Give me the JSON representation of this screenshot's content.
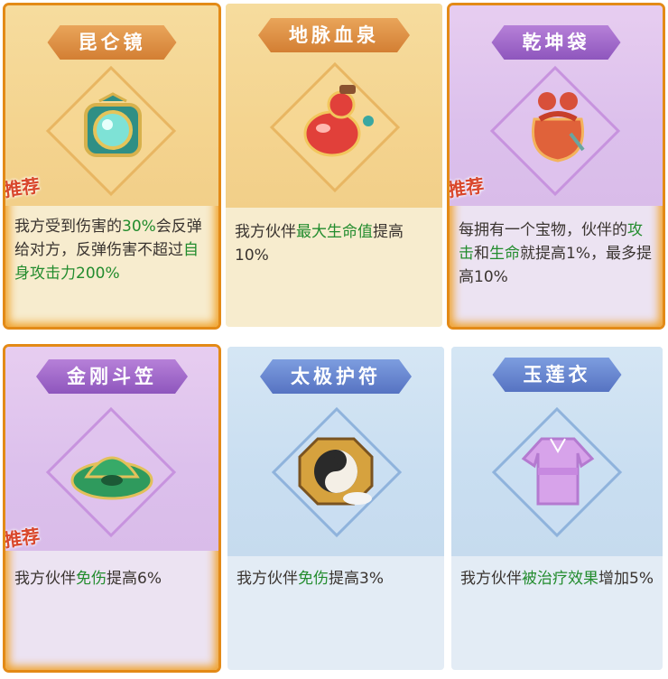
{
  "cards": [
    {
      "name": "昆仑镜",
      "theme": "gold",
      "recommended": true,
      "desc": [
        {
          "t": "我方受到伤害的"
        },
        {
          "t": "30%",
          "h": true
        },
        {
          "t": "会反弹给对方，反弹伤害不超过"
        },
        {
          "t": "自身攻击力200%",
          "h": true
        }
      ]
    },
    {
      "name": "地脉血泉",
      "theme": "gold",
      "recommended": false,
      "desc": [
        {
          "t": "我方伙伴"
        },
        {
          "t": "最大生命值",
          "h": true
        },
        {
          "t": "提高10%"
        }
      ]
    },
    {
      "name": "乾坤袋",
      "theme": "purple",
      "recommended": true,
      "desc": [
        {
          "t": "每拥有一个宝物，伙伴的"
        },
        {
          "t": "攻击",
          "h": true
        },
        {
          "t": "和"
        },
        {
          "t": "生命",
          "h": true
        },
        {
          "t": "就提高1%，最多提高10%"
        }
      ]
    },
    {
      "name": "金刚斗笠",
      "theme": "purple",
      "recommended": true,
      "desc": [
        {
          "t": "我方伙伴"
        },
        {
          "t": "免伤",
          "h": true
        },
        {
          "t": "提高6%"
        }
      ]
    },
    {
      "name": "太极护符",
      "theme": "blue",
      "recommended": false,
      "desc": [
        {
          "t": "我方伙伴"
        },
        {
          "t": "免伤",
          "h": true
        },
        {
          "t": "提高3%"
        }
      ]
    },
    {
      "name": "玉莲衣",
      "theme": "blue",
      "recommended": false,
      "desc": [
        {
          "t": "我方伙伴"
        },
        {
          "t": "被治疗效果",
          "h": true
        },
        {
          "t": "增加5%"
        }
      ]
    }
  ],
  "badge_text": "推荐",
  "colors": {
    "highlight": "#238c2e",
    "featured_border": "#e38a17"
  }
}
